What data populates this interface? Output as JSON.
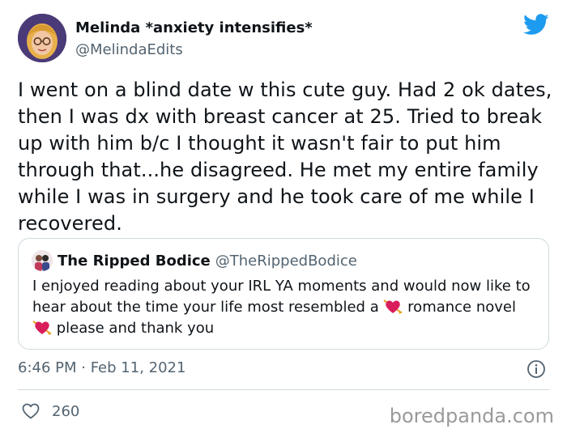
{
  "tweet": {
    "display_name": "Melinda *anxiety intensifies*",
    "handle": "@MelindaEdits",
    "avatar_icon": "cartoon-avatar-with-glasses",
    "brand_icon": "twitter-bird-icon",
    "brand_color": "#1d9bf0",
    "text": "I went on a blind date w this cute guy. Had 2 ok dates, then I was dx with breast cancer at 25. Tried to break up with him b/c I thought it wasn't fair to put him through that...he disagreed. He met my entire family while I was in surgery and he took care of me while I recovered.",
    "timestamp": "6:46 PM · Feb 11, 2021",
    "like_count": "260"
  },
  "quote": {
    "display_name": "The Ripped Bodice",
    "handle": "@TheRippedBodice",
    "text_part1": "I enjoyed reading about your IRL YA  moments and would now like to hear about the time your life most resembled a ",
    "text_part2": " romance novel",
    "text_part3": " please and thank you",
    "emoji": "heart-with-arrow-emoji"
  },
  "footer": {
    "watermark": "boredpanda.com"
  },
  "colors": {
    "text": "#0f1419",
    "secondary": "#536471",
    "border": "#cfd9de"
  }
}
